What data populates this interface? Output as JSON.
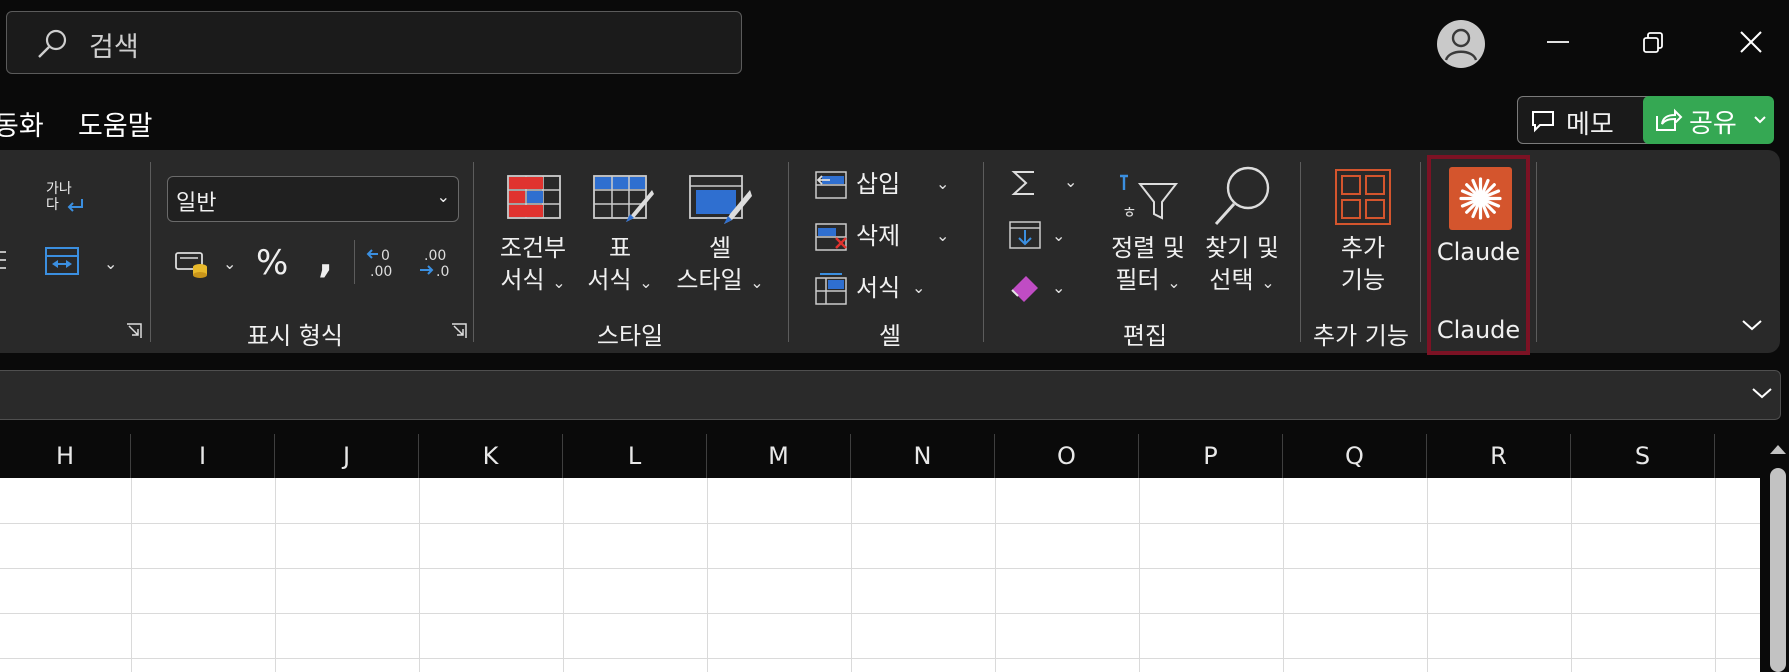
{
  "search": {
    "placeholder": "검색"
  },
  "menu": {
    "partial_tab": "동화",
    "help": "도움말"
  },
  "header_buttons": {
    "memo": "메모",
    "share": "공유"
  },
  "ribbon": {
    "alignment": {
      "wrap_text": "가나\n다"
    },
    "number": {
      "format_value": "일반",
      "percent": "%",
      "comma": ",",
      "group_label": "표시 형식"
    },
    "styles": {
      "conditional_l1": "조건부",
      "conditional_l2": "서식",
      "table_l1": "표",
      "table_l2": "서식",
      "cell_l1": "셀",
      "cell_l2": "스타일",
      "group_label": "스타일"
    },
    "cells": {
      "insert": "삽입",
      "delete": "삭제",
      "format": "서식",
      "group_label": "셀"
    },
    "editing": {
      "sort_l1": "정렬 및",
      "sort_l2": "필터",
      "find_l1": "찾기 및",
      "find_l2": "선택",
      "group_label": "편집"
    },
    "addins": {
      "btn_l1": "추가",
      "btn_l2": "기능",
      "group_label": "추가 기능"
    },
    "claude": {
      "btn": "Claude",
      "group_label": "Claude"
    }
  },
  "columns": [
    "H",
    "I",
    "J",
    "K",
    "L",
    "M",
    "N",
    "O",
    "P",
    "Q",
    "R",
    "S"
  ],
  "colors": {
    "share_green": "#35a853",
    "claude_orange": "#d4552d",
    "highlight": "#7c1224",
    "addin_orange": "#d4552d"
  }
}
